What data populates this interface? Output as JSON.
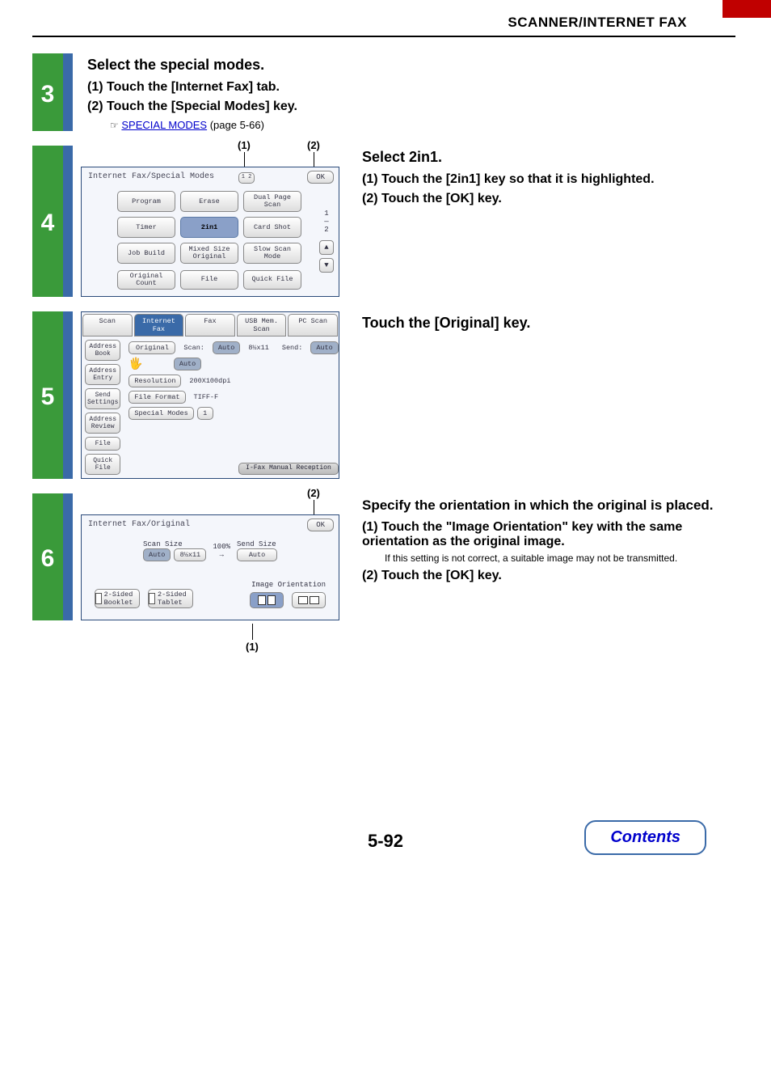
{
  "header": {
    "title": "SCANNER/INTERNET FAX"
  },
  "step3": {
    "num": "3",
    "title": "Select the special modes.",
    "items": [
      {
        "n": "(1)",
        "text": "Touch the [Internet Fax] tab."
      },
      {
        "n": "(2)",
        "text": "Touch the [Special Modes] key."
      }
    ],
    "link": "SPECIAL MODES",
    "link_after": " (page 5-66)",
    "pointer": "☞"
  },
  "step4": {
    "num": "4",
    "callouts": {
      "c1": "(1)",
      "c2": "(2)"
    },
    "panel": {
      "title": "Internet Fax/Special Modes",
      "ok": "OK",
      "buttons": {
        "program": "Program",
        "erase": "Erase",
        "dual": "Dual Page Scan",
        "timer": "Timer",
        "2in1": "2in1",
        "card": "Card Shot",
        "job": "Job Build",
        "mixed": "Mixed Size Original",
        "slow": "Slow Scan Mode",
        "orig": "Original Count",
        "file": "File",
        "quick": "Quick File"
      },
      "frac_top": "1",
      "frac_bot": "2"
    },
    "title": "Select 2in1.",
    "items": [
      {
        "n": "(1)",
        "text": "Touch the [2in1] key so that it is highlighted."
      },
      {
        "n": "(2)",
        "text": "Touch the [OK] key."
      }
    ]
  },
  "step5": {
    "num": "5",
    "title": "Touch the [Original] key.",
    "panel": {
      "tabs": {
        "scan": "Scan",
        "ifax": "Internet Fax",
        "fax": "Fax",
        "usb": "USB Mem. Scan",
        "pc": "PC Scan"
      },
      "side": {
        "ab": "Address Book",
        "ae": "Address Entry",
        "ss": "Send Settings",
        "ar": "Address Review",
        "file": "File",
        "qf": "Quick File"
      },
      "rows": {
        "original": "Original",
        "scan_label": "Scan:",
        "auto": "Auto",
        "size": "8½x11",
        "send_label": "Send:",
        "send_auto": "Auto",
        "exposure_auto": "Auto",
        "resolution": "Resolution",
        "res_val": "200X100dpi",
        "ff": "File Format",
        "ff_val": "TIFF-F",
        "sm": "Special Modes"
      },
      "pill": "I-Fax Manual Reception"
    }
  },
  "step6": {
    "num": "6",
    "callouts": {
      "c1": "(1)",
      "c2": "(2)"
    },
    "panel": {
      "title": "Internet Fax/Original",
      "ok": "OK",
      "scan_size": "Scan Size",
      "auto": "Auto",
      "paper": "8½x11",
      "pct": "100%",
      "send_size": "Send Size",
      "send_auto": "Auto",
      "arrow": "→",
      "orient_label": "Image Orientation",
      "b1": "2-Sided Booklet",
      "b2": "2-Sided Tablet"
    },
    "title": "Specify the orientation in which the original is placed.",
    "items": [
      {
        "n": "(1)",
        "text": "Touch the \"Image Orientation\" key with the same orientation as the original image."
      },
      {
        "n": "(2)",
        "text": "Touch the [OK] key."
      }
    ],
    "note": "If this setting is not correct, a suitable image may not be transmitted."
  },
  "footer": {
    "page": "5-92",
    "contents": "Contents"
  }
}
